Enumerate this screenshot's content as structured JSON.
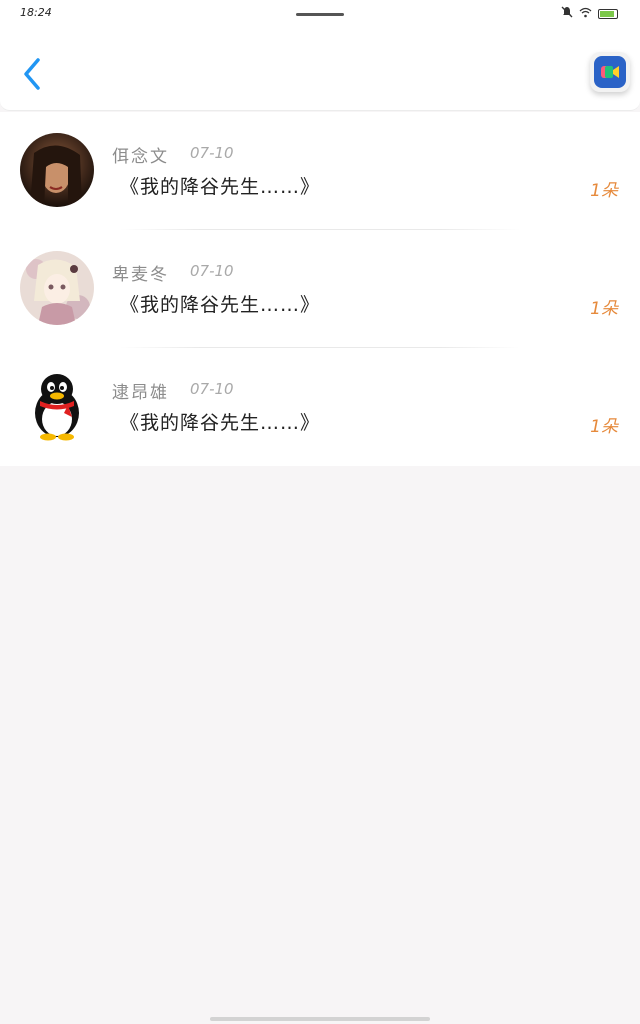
{
  "status_bar": {
    "time": "18:24",
    "icons": [
      "mute-icon",
      "wifi-icon",
      "battery-icon"
    ],
    "battery_level": 0.85
  },
  "header": {
    "back_icon": "chevron-left-icon",
    "action_icon": "video-camera-icon",
    "accent_color": "#2196f3"
  },
  "items": [
    {
      "name": "佴念文",
      "date": "07-10",
      "title": "《我的降谷先生……》",
      "count": "1朵",
      "avatar": "photo-avatar"
    },
    {
      "name": "卑麦冬",
      "date": "07-10",
      "title": "《我的降谷先生……》",
      "count": "1朵",
      "avatar": "anime-avatar"
    },
    {
      "name": "逮昂雄",
      "date": "07-10",
      "title": "《我的降谷先生……》",
      "count": "1朵",
      "avatar": "penguin-avatar"
    }
  ],
  "colors": {
    "count": "#e68a3c",
    "name": "#8c8c8c",
    "date": "#a9a9a9",
    "title": "#222222"
  }
}
